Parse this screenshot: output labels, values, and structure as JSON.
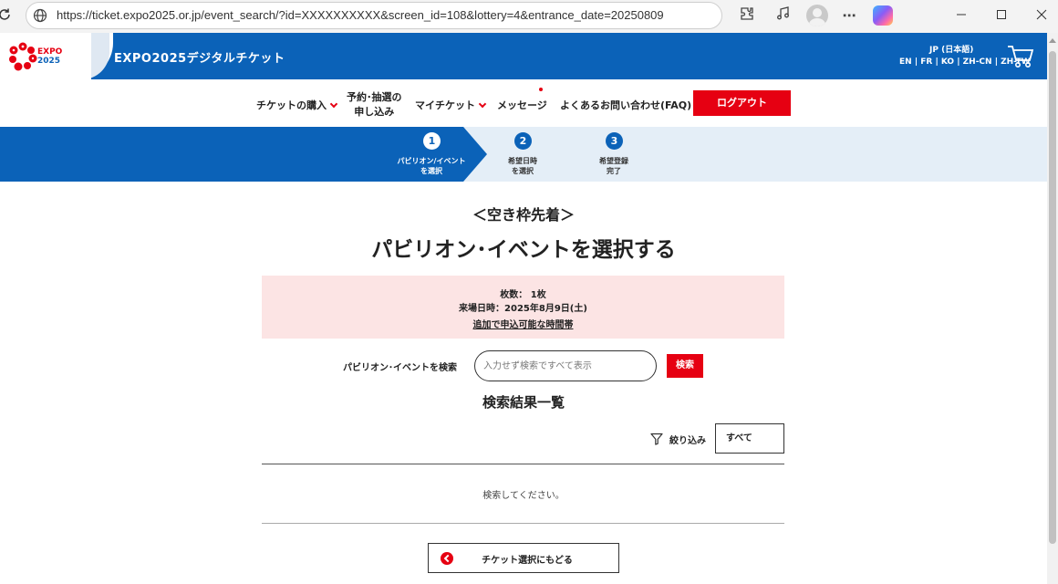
{
  "browser": {
    "url": "https://ticket.expo2025.or.jp/event_search/?id=XXXXXXXXXX&screen_id=108&lottery=4&entrance_date=20250809"
  },
  "header": {
    "logo_text_top": "EXPO",
    "logo_text_bottom": "2025",
    "site_title": "EXPO2025デジタルチケット",
    "language_current": "JP (日本語)",
    "language_options": "EN | FR | KO | ZH-CN | ZH-TW",
    "brand_blue": "#0b62b8",
    "brand_red": "#e60012"
  },
  "nav": {
    "buy_tickets": "チケットの購入",
    "reserve_line1": "予約･抽選の",
    "reserve_line2": "申し込み",
    "my_tickets": "マイチケット",
    "messages": "メッセージ",
    "faq": "よくあるお問い合わせ(FAQ)",
    "logout": "ログアウト"
  },
  "steps": [
    {
      "number": "1",
      "line1": "パビリオン/イベント",
      "line2": "を選択",
      "active": true
    },
    {
      "number": "2",
      "line1": "希望日時",
      "line2": "を選択",
      "active": false
    },
    {
      "number": "3",
      "line1": "希望登録",
      "line2": "完了",
      "active": false
    }
  ],
  "main": {
    "subtitle": "＜空き枠先着＞",
    "title": "パビリオン･イベントを選択する",
    "tickets": "枚数： 1枚",
    "visit_date": "来場日時：2025年8月9日(土)",
    "time_slots_link": "追加で申込可能な時間帯",
    "search_label": "パビリオン･イベントを検索",
    "search_placeholder": "入力せず検索ですべて表示",
    "search_button": "検索",
    "results_title": "検索結果一覧",
    "filter_label": "絞り込み",
    "filter_value": "すべて",
    "empty_message": "検索してください。",
    "back_button": "チケット選択にもどる"
  }
}
